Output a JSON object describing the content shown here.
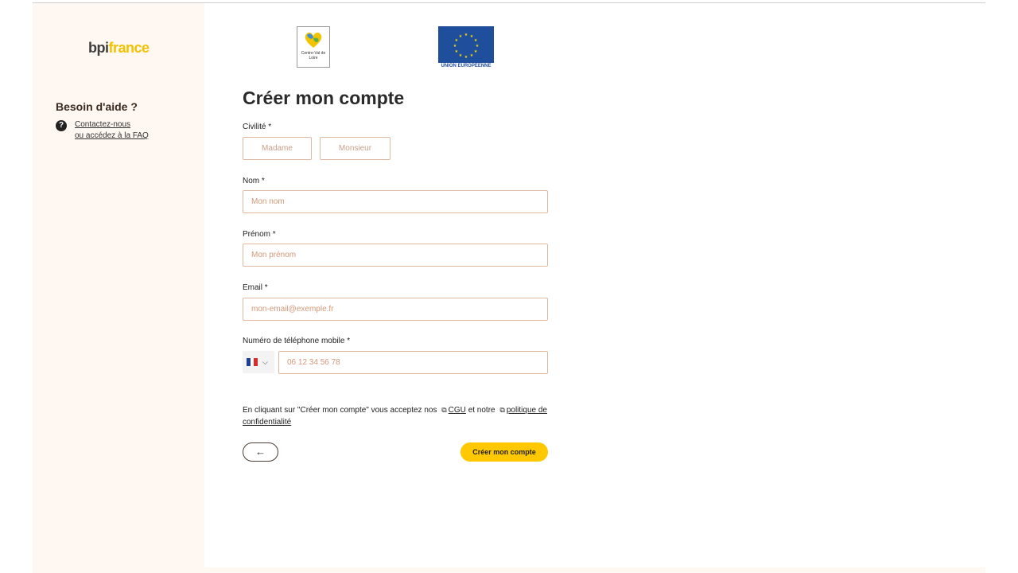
{
  "brand": {
    "part1": "bpi",
    "part2": "france"
  },
  "help": {
    "title": "Besoin d'aide ?",
    "link_contact": "Contactez-nous",
    "link_faq": "ou accédez à la FAQ"
  },
  "logos": {
    "region_text": "Centre-Val de Loire",
    "eu_text": "UNION EUROPÉENNE"
  },
  "form": {
    "title": "Créer mon compte",
    "civility": {
      "label": "Civilité *",
      "option_madame": "Madame",
      "option_monsieur": "Monsieur"
    },
    "nom": {
      "label": "Nom *",
      "placeholder": "Mon nom"
    },
    "prenom": {
      "label": "Prénom *",
      "placeholder": "Mon prénom"
    },
    "email": {
      "label": "Email *",
      "placeholder": "mon-email@exemple.fr"
    },
    "phone": {
      "label": "Numéro de téléphone mobile *",
      "placeholder": "06 12 34 56 78"
    },
    "terms": {
      "prefix": "En cliquant sur \"Créer mon compte\" vous acceptez nos",
      "cgu": "CGU",
      "middle": "et notre",
      "policy": "politique de confidentialité"
    },
    "back_symbol": "←",
    "submit_label": "Créer mon compte"
  },
  "colors": {
    "sidebar_bg": "#fff7f1",
    "accent": "#ffc800",
    "input_border": "#e0b9a2",
    "placeholder": "#d49878",
    "eu_blue": "#1f4e9c"
  },
  "icons": {
    "help": "question-circle-icon",
    "external": "external-link-icon",
    "back": "arrow-left-icon",
    "chevron": "chevron-down-icon"
  }
}
